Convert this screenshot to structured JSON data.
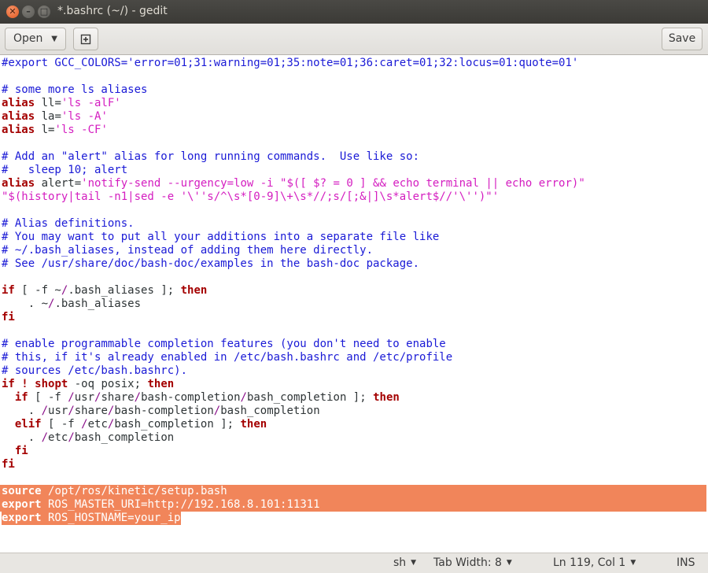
{
  "window": {
    "title": "*.bashrc (~/) - gedit",
    "controls": {
      "close": "✕",
      "minimize": "–",
      "maximize": "□"
    }
  },
  "header": {
    "open_label": "Open",
    "new_tab_icon": "new-document-icon",
    "save_label": "Save"
  },
  "editor": {
    "lines": [
      "#export GCC_COLORS='error=01;31:warning=01;35:note=01;36:caret=01;32:locus=01:quote=01'",
      "",
      "# some more ls aliases",
      "alias ll='ls -alF'",
      "alias la='ls -A'",
      "alias l='ls -CF'",
      "",
      "# Add an \"alert\" alias for long running commands.  Use like so:",
      "#   sleep 10; alert",
      "alias alert='notify-send --urgency=low -i \"$([ $? = 0 ] && echo terminal || echo error)\"",
      "\"$(history|tail -n1|sed -e '\\''s/^\\s*[0-9]\\+\\s*//;s/[;&|]\\s*alert$//'\\'')\"'",
      "",
      "# Alias definitions.",
      "# You may want to put all your additions into a separate file like",
      "# ~/.bash_aliases, instead of adding them here directly.",
      "# See /usr/share/doc/bash-doc/examples in the bash-doc package.",
      "",
      "if [ -f ~/.bash_aliases ]; then",
      "    . ~/.bash_aliases",
      "fi",
      "",
      "# enable programmable completion features (you don't need to enable",
      "# this, if it's already enabled in /etc/bash.bashrc and /etc/profile",
      "# sources /etc/bash.bashrc).",
      "if ! shopt -oq posix; then",
      "  if [ -f /usr/share/bash-completion/bash_completion ]; then",
      "    . /usr/share/bash-completion/bash_completion",
      "  elif [ -f /etc/bash_completion ]; then",
      "    . /etc/bash_completion",
      "  fi",
      "fi",
      "",
      "source /opt/ros/kinetic/setup.bash",
      "export ROS_MASTER_URI=http://192.168.8.101:11311",
      "export ROS_HOSTNAME=your_ip"
    ],
    "selection_color": "#f1855a"
  },
  "statusbar": {
    "language": "sh",
    "tab_width": "Tab Width: 8",
    "position": "Ln 119, Col 1",
    "mode": "INS"
  },
  "colors": {
    "comment": "#1a1ad6",
    "keyword": "#a40000",
    "string": "#d41dc0",
    "titlebar": "#3b3a36",
    "close_button": "#e2571e"
  }
}
